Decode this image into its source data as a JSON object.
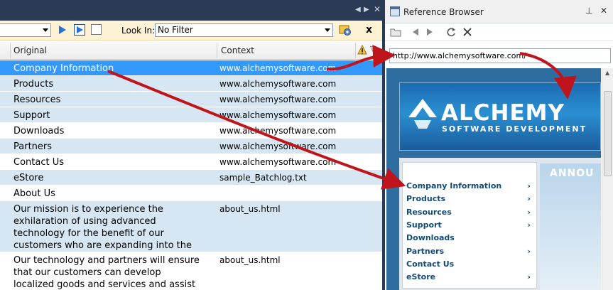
{
  "left": {
    "toolbar": {
      "look_in_label": "Look In:",
      "look_in_value": "No Filter",
      "close_label": "x"
    },
    "columns": {
      "original": "Original",
      "context": "Context"
    },
    "rows": [
      {
        "original": "Company Information",
        "context": "www.alchemysoftware.com"
      },
      {
        "original": "Products",
        "context": "www.alchemysoftware.com"
      },
      {
        "original": "Resources",
        "context": "www.alchemysoftware.com"
      },
      {
        "original": "Support",
        "context": "www.alchemysoftware.com"
      },
      {
        "original": "Downloads",
        "context": "www.alchemysoftware.com"
      },
      {
        "original": "Partners",
        "context": "www.alchemysoftware.com"
      },
      {
        "original": "Contact Us",
        "context": "www.alchemysoftware.com"
      },
      {
        "original": "eStore",
        "context": "sample_Batchlog.txt"
      },
      {
        "original": "About Us",
        "context": ""
      },
      {
        "original": "Our mission is to experience the exhilaration of using advanced technology for the benefit of our customers who are expanding into the global marketplace.",
        "context": "about_us.html"
      },
      {
        "original": "Our technology and partners will ensure that our customers can develop localized goods and services and assist them in expanding",
        "context": "about_us.html"
      }
    ]
  },
  "right": {
    "title": "Reference Browser",
    "url": "http://www.alchemysoftware.com/",
    "logo": "ALCHEMY",
    "logo_sub": "SOFTWARE DEVELOPMENT",
    "announce": "ANNOU",
    "nav": [
      {
        "label": "Company Information",
        "chevron": "›"
      },
      {
        "label": "Products",
        "chevron": "›"
      },
      {
        "label": "Resources",
        "chevron": "›"
      },
      {
        "label": "Support",
        "chevron": "›"
      },
      {
        "label": "Downloads",
        "chevron": ""
      },
      {
        "label": "Partners",
        "chevron": "›"
      },
      {
        "label": "Contact Us",
        "chevron": ""
      },
      {
        "label": "eStore",
        "chevron": "›"
      }
    ]
  },
  "colors": {
    "selection": "#3399ff",
    "alt_row": "#d6e6f2",
    "arrow": "#c0141c",
    "nav_text": "#114b78"
  }
}
